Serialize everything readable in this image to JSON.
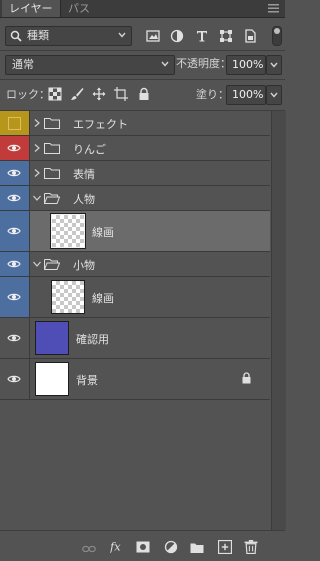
{
  "tabs": [
    {
      "label": "レイヤー",
      "active": true
    },
    {
      "label": "パス",
      "active": false
    }
  ],
  "filter": {
    "kind_label": "種類",
    "icons": [
      "pixel-filter-icon",
      "adjustment-filter-icon",
      "type-filter-icon",
      "shape-filter-icon",
      "smart-object-filter-icon"
    ]
  },
  "blend": {
    "mode": "通常",
    "opacity_label": "不透明度：",
    "opacity_value": "100%"
  },
  "lock": {
    "label": "ロック：",
    "fill_label": "塗り：",
    "fill_value": "100%"
  },
  "layers": [
    {
      "name": "エフェクト",
      "type": "group",
      "visible": false,
      "color": "#b8961b"
    },
    {
      "name": "りんご",
      "type": "group",
      "visible": true,
      "color": "#c23b3b"
    },
    {
      "name": "表情",
      "type": "group",
      "visible": true,
      "color": "#4c6fa0"
    },
    {
      "name": "人物",
      "type": "group",
      "visible": true,
      "color": "#4c6fa0",
      "expanded": true
    },
    {
      "name": "線画",
      "type": "layer",
      "visible": true,
      "color": "#4c6fa0",
      "selected": true,
      "thumb": "transparent"
    },
    {
      "name": "小物",
      "type": "group",
      "visible": true,
      "color": "#4c6fa0",
      "expanded": true
    },
    {
      "name": "線画",
      "type": "layer",
      "visible": true,
      "color": "#4c6fa0",
      "thumb": "transparent"
    },
    {
      "name": "確認用",
      "type": "layer",
      "visible": true,
      "color": "",
      "thumb": "#4f4db6"
    },
    {
      "name": "背景",
      "type": "layer",
      "visible": true,
      "color": "",
      "thumb": "#ffffff",
      "locked": true
    }
  ],
  "bottom_icons": [
    "link-layers-icon",
    "fx-icon",
    "add-mask-icon",
    "adjustment-layer-icon",
    "new-group-icon",
    "new-layer-icon",
    "delete-layer-icon"
  ],
  "colors": {
    "panel_bg": "#535353",
    "selected_row": "#6b6b6b",
    "yellow_label": "#b8961b",
    "red_label": "#c23b3b",
    "blue_label": "#4c6fa0"
  }
}
